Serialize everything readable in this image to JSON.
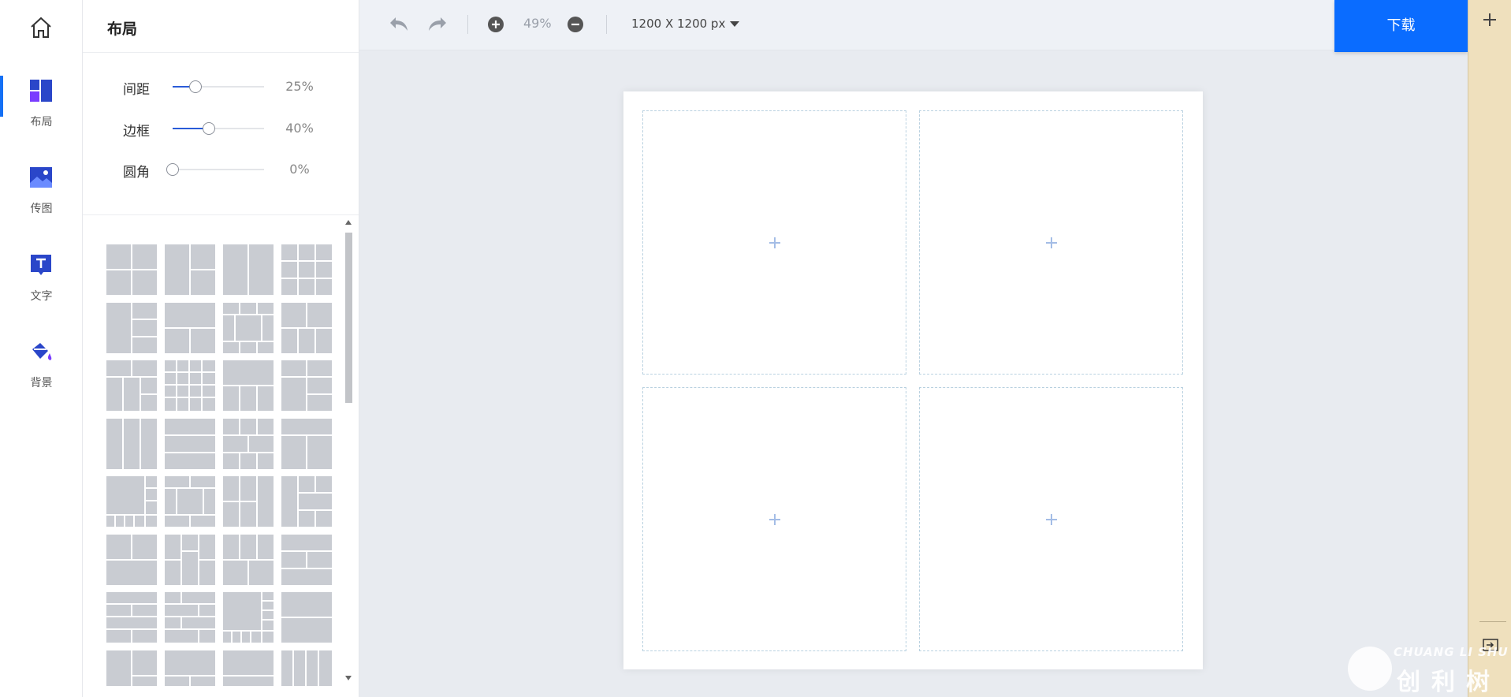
{
  "nav": {
    "home_icon": "home-icon",
    "items": [
      {
        "label": "布局",
        "icon": "layout-icon",
        "active": true
      },
      {
        "label": "传图",
        "icon": "image-upload-icon",
        "active": false
      },
      {
        "label": "文字",
        "icon": "text-icon",
        "active": false
      },
      {
        "label": "背景",
        "icon": "paint-bucket-icon",
        "active": false
      }
    ]
  },
  "panel": {
    "title": "布局",
    "sliders": [
      {
        "name": "间距",
        "value": 0.25,
        "display": "25%"
      },
      {
        "name": "边框",
        "value": 0.4,
        "display": "40%"
      },
      {
        "name": "圆角",
        "value": 0.0,
        "display": "0%"
      }
    ]
  },
  "toolbar": {
    "zoom": "49%",
    "canvas_size": "1200 X 1200 px",
    "download_label": "下载"
  },
  "colors": {
    "accent": "#0a6cff",
    "nav_icon": "#2a46c9",
    "template_tile": "#c9ccd2",
    "cell_border": "#b9d1e0"
  },
  "watermark": {
    "latin": "CHUANG LI SHU",
    "cjk": "创利树"
  }
}
